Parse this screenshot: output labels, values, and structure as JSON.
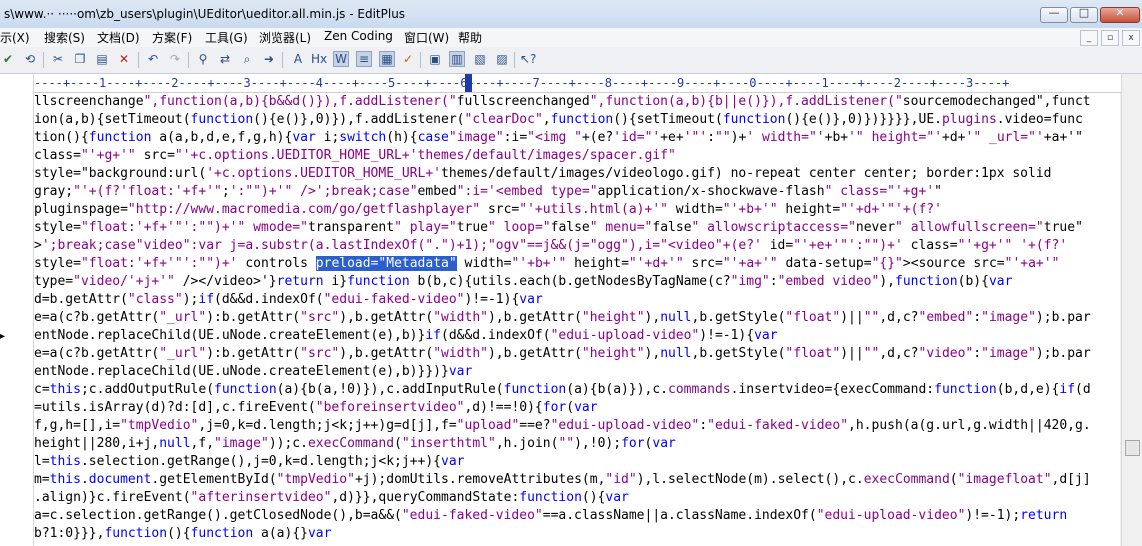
{
  "window": {
    "title": "s\\www.·· ·····om\\zb_users\\plugin\\UEditor\\ueditor.all.min.js - EditPlus"
  },
  "window_buttons": {
    "minimize": "—",
    "maximize": "□",
    "close": "✕"
  },
  "menu": [
    "示(X)",
    "搜索(S)",
    "文档(D)",
    "方案(F)",
    "工具(G)",
    "浏览器(L)",
    "Zen Coding",
    "窗口(W)",
    "帮助"
  ],
  "mdi_buttons": [
    "_",
    "▫",
    "x"
  ],
  "toolbar_icons": [
    "check-icon",
    "refresh-icon",
    "cut-icon",
    "copy-icon",
    "paste-icon",
    "delete-icon",
    "undo-icon",
    "redo-icon",
    "find-icon",
    "replace-icon",
    "find-in-files-icon",
    "goto-icon",
    "font-icon",
    "hex-icon",
    "word-wrap-icon",
    "line-numbers-icon",
    "column-select-icon",
    "spellcheck-icon",
    "whitespace-icon",
    "cliptext-icon",
    "directory-icon",
    "output-icon",
    "help-cursor-icon"
  ],
  "ruler": "----+----1----+----2----+----3----+----4----+----5----+----6----+----7----+----8----+----9----+----0----+----1----+----2----+----3----+",
  "selection": "preload=\"Metadata\"",
  "code": [
    "llscreenchange\",function(a,b){b&&d()}),f.addListener(\"fullscreenchanged\",function(a,b){b||e()}),f.addListener(\"sourcemodechanged\",funct",
    "ion(a,b){setTimeout(function(){e()},0)}),f.addListener(\"clearDoc\",function(){setTimeout(function(){e()},0)})}}}},UE.plugins.video=func",
    "tion(){function a(a,b,d,e,f,g,h){var i;switch(h){case\"image\":i=\"<img \"+(e?'id=\"'+e+'\"':\"\")+' width=\"'+b+'\" height=\"'+d+'\" _url=\"'+a+'\"",
    "class=\"'+g+'\" src=\"'+c.options.UEDITOR_HOME_URL+'themes/default/images/spacer.gif\"",
    "style=\"background:url('+c.options.UEDITOR_HOME_URL+'themes/default/images/videologo.gif) no-repeat center center; border:1px solid",
    "gray;\"'+(f?'float:'+f+'\";':\"\")+'\" />';break;case\"embed\":i='<embed type=\"application/x-shockwave-flash\" class=\"'+g+'\"",
    "pluginspage=\"http://www.macromedia.com/go/getflashplayer\" src=\"'+utils.html(a)+'\" width=\"'+b+'\" height=\"'+d+'\"'+(f?'",
    "style=\"float:'+f+'\"':\"\")+'\" wmode=\"transparent\" play=\"true\" loop=\"false\" menu=\"false\" allowscriptaccess=\"never\" allowfullscreen=\"true\"",
    ">';break;case\"video\":var j=a.substr(a.lastIndexOf(\".\")+1);\"ogv\"==j&&(j=\"ogg\"),i=\"<video\"+(e?' id=\"'+e+'\"':\"\")+' class=\"'+g+'\" '+(f?'",
    "style=\"float:'+f+'\"':\"\")+' controls preload=\"Metadata\" width=\"'+b+'\" height=\"'+d+'\" src=\"'+a+'\" data-setup=\"{}\"><source src=\"'+a+'\"",
    "type=\"video/'+j+'\" /></video>'}return i}function b(b,c){utils.each(b.getNodesByTagName(c?\"img\":\"embed video\"),function(b){var",
    "d=b.getAttr(\"class\");if(d&&d.indexOf(\"edui-faked-video\")!=-1){var",
    "e=a(c?b.getAttr(\"_url\"):b.getAttr(\"src\"),b.getAttr(\"width\"),b.getAttr(\"height\"),null,b.getStyle(\"float\")||\"\",d,c?\"embed\":\"image\");b.par",
    "entNode.replaceChild(UE.uNode.createElement(e),b)}if(d&&d.indexOf(\"edui-upload-video\")!=-1){var",
    "e=a(c?b.getAttr(\"_url\"):b.getAttr(\"src\"),b.getAttr(\"width\"),b.getAttr(\"height\"),null,b.getStyle(\"float\")||\"\",d,c?\"video\":\"image\");b.par",
    "entNode.replaceChild(UE.uNode.createElement(e),b)}})}var",
    "c=this;c.addOutputRule(function(a){b(a,!0)}),c.addInputRule(function(a){b(a)}),c.commands.insertvideo={execCommand:function(b,d,e){if(d",
    "=utils.isArray(d)?d:[d],c.fireEvent(\"beforeinsertvideo\",d)!==!0){for(var",
    "f,g,h=[],i=\"tmpVedio\",j=0,k=d.length;j<k;j++)g=d[j],f=\"upload\"==e?\"edui-upload-video\":\"edui-faked-video\",h.push(a(g.url,g.width||420,g.",
    "height||280,i+j,null,f,\"image\"));c.execCommand(\"inserthtml\",h.join(\"\"),!0);for(var",
    "l=this.selection.getRange(),j=0,k=d.length;j<k;j++){var",
    "m=this.document.getElementById(\"tmpVedio\"+j);domUtils.removeAttributes(m,\"id\"),l.selectNode(m).select(),c.execCommand(\"imagefloat\",d[j]",
    ".align)}c.fireEvent(\"afterinsertvideo\",d)}},queryCommandState:function(){var",
    "a=c.selection.getRange().getClosedNode(),b=a&&(\"edui-faked-video\"==a.className||a.className.indexOf(\"edui-upload-video\")!=-1);return",
    "b?1:0}}},function(){function a(a){}var"
  ]
}
